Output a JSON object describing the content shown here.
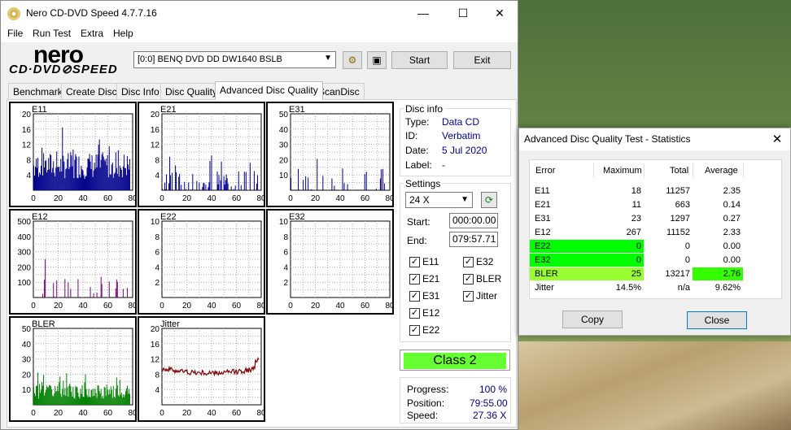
{
  "window": {
    "title": "Nero CD-DVD Speed 4.7.7.16",
    "minimize": "—",
    "maximize": "☐",
    "close": "✕"
  },
  "menu": [
    "File",
    "Run Test",
    "Extra",
    "Help"
  ],
  "logo": {
    "line1": "nero",
    "line2": "CD·DVD⊘SPEED"
  },
  "toolbar": {
    "drive": "[0:0]   BENQ DVD DD DW1640 BSLB",
    "start": "Start",
    "exit": "Exit"
  },
  "tabs": [
    "Benchmark",
    "Create Disc",
    "Disc Info",
    "Disc Quality",
    "Advanced Disc Quality",
    "ScanDisc"
  ],
  "active_tab": "Advanced Disc Quality",
  "disc_info": {
    "title": "Disc info",
    "type_label": "Type:",
    "type": "Data CD",
    "id_label": "ID:",
    "id": "Verbatim",
    "date_label": "Date:",
    "date": "5 Jul 2020",
    "label_label": "Label:",
    "label": "-"
  },
  "settings": {
    "title": "Settings",
    "speed": "24 X",
    "start_label": "Start:",
    "start": "000:00.00",
    "end_label": "End:",
    "end": "079:57.71",
    "checks": {
      "e11": "E11",
      "e21": "E21",
      "e31": "E31",
      "e12": "E12",
      "e22": "E22",
      "e32": "E32",
      "bler": "BLER",
      "jitter": "Jitter"
    }
  },
  "class_result": "Class 2",
  "progress": {
    "progress_label": "Progress:",
    "progress": "100 %",
    "position_label": "Position:",
    "position": "79:55.00",
    "speed_label": "Speed:",
    "speed": "27.36 X"
  },
  "chart_data": [
    {
      "type": "bar",
      "name": "E11",
      "xlabels": [
        "0",
        "20",
        "40",
        "60",
        "80"
      ],
      "ylabels": [
        "20",
        "16",
        "12",
        "8",
        "4"
      ],
      "ylim": [
        0,
        20
      ],
      "xlim": [
        0,
        80
      ],
      "color": "#00008b"
    },
    {
      "type": "bar",
      "name": "E21",
      "xlabels": [
        "0",
        "20",
        "40",
        "60",
        "80"
      ],
      "ylabels": [
        "20",
        "16",
        "12",
        "8",
        "4"
      ],
      "ylim": [
        0,
        20
      ],
      "xlim": [
        0,
        80
      ],
      "color": "#00008b"
    },
    {
      "type": "bar",
      "name": "E31",
      "xlabels": [
        "0",
        "20",
        "40",
        "60",
        "80"
      ],
      "ylabels": [
        "50",
        "40",
        "30",
        "20",
        "10"
      ],
      "ylim": [
        0,
        50
      ],
      "xlim": [
        0,
        80
      ],
      "color": "#00008b"
    },
    {
      "type": "bar",
      "name": "E12",
      "xlabels": [
        "0",
        "20",
        "40",
        "60",
        "80"
      ],
      "ylabels": [
        "500",
        "400",
        "300",
        "200",
        "100"
      ],
      "ylim": [
        0,
        500
      ],
      "xlim": [
        0,
        80
      ],
      "color": "#800080"
    },
    {
      "type": "bar",
      "name": "E22",
      "xlabels": [
        "0",
        "20",
        "40",
        "60",
        "80"
      ],
      "ylabels": [
        "10",
        "8",
        "6",
        "4",
        "2"
      ],
      "ylim": [
        0,
        10
      ],
      "xlim": [
        0,
        80
      ],
      "color": "#800080"
    },
    {
      "type": "bar",
      "name": "E32",
      "xlabels": [
        "0",
        "20",
        "40",
        "60",
        "80"
      ],
      "ylabels": [
        "10",
        "8",
        "6",
        "4",
        "2"
      ],
      "ylim": [
        0,
        10
      ],
      "xlim": [
        0,
        80
      ],
      "color": "#800080"
    },
    {
      "type": "bar",
      "name": "BLER",
      "xlabels": [
        "0",
        "20",
        "40",
        "60",
        "80"
      ],
      "ylabels": [
        "50",
        "40",
        "30",
        "20",
        "10"
      ],
      "ylim": [
        0,
        50
      ],
      "xlim": [
        0,
        80
      ],
      "color": "#008000"
    },
    {
      "type": "line",
      "name": "Jitter",
      "xlabels": [
        "0",
        "20",
        "40",
        "60",
        "80"
      ],
      "ylabels": [
        "20",
        "16",
        "12",
        "8",
        "4"
      ],
      "ylim": [
        0,
        20
      ],
      "xlim": [
        0,
        80
      ],
      "color": "#800000"
    }
  ],
  "stats": {
    "title": "Advanced Disc Quality Test - Statistics",
    "headers": [
      "Error",
      "Maximum",
      "Total",
      "Average"
    ],
    "rows": [
      {
        "error": "E11",
        "max": "18",
        "total": "11257",
        "avg": "2.35",
        "hl_name": "",
        "hl_avg": ""
      },
      {
        "error": "E21",
        "max": "11",
        "total": "663",
        "avg": "0.14",
        "hl_name": "",
        "hl_avg": ""
      },
      {
        "error": "E31",
        "max": "23",
        "total": "1297",
        "avg": "0.27",
        "hl_name": "",
        "hl_avg": ""
      },
      {
        "error": "E12",
        "max": "267",
        "total": "11152",
        "avg": "2.33",
        "hl_name": "",
        "hl_avg": ""
      },
      {
        "error": "E22",
        "max": "0",
        "total": "0",
        "avg": "0.00",
        "hl_name": "#00ff00",
        "hl_avg": ""
      },
      {
        "error": "E32",
        "max": "0",
        "total": "0",
        "avg": "0.00",
        "hl_name": "#00ff00",
        "hl_avg": ""
      },
      {
        "error": "BLER",
        "max": "25",
        "total": "13217",
        "avg": "2.76",
        "hl_name": "#99ff33",
        "hl_avg": "#33ff00"
      },
      {
        "error": "Jitter",
        "max": "14.5%",
        "total": "n/a",
        "avg": "9.62%",
        "hl_name": "",
        "hl_avg": ""
      }
    ],
    "copy": "Copy",
    "close": "Close"
  }
}
